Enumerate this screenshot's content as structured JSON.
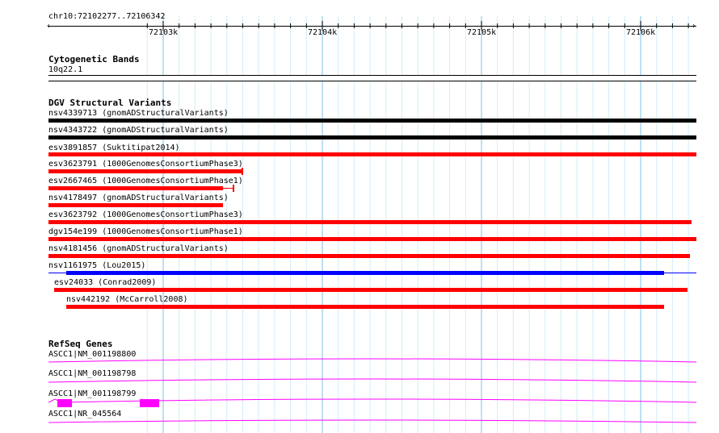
{
  "coords": "chr10:72102277..72106342",
  "ruler": {
    "ticks": [
      "72103k",
      "72104k",
      "72105k",
      "72106k"
    ]
  },
  "tracks": {
    "cytoband": {
      "title": "Cytogenetic Bands",
      "band": "10q22.1"
    },
    "dgv": {
      "title": "DGV Structural Variants",
      "items": [
        {
          "label": "nsv4339713 (gnomADStructuralVariants)",
          "color": "#000000"
        },
        {
          "label": "nsv4343722 (gnomADStructuralVariants)",
          "color": "#000000"
        },
        {
          "label": "esv3891857 (Suktitipat2014)",
          "color": "#ff0000"
        },
        {
          "label": "esv3623791 (1000GenomesConsortiumPhase3)",
          "color": "#ff0000"
        },
        {
          "label": "esv2667465 (1000GenomesConsortiumPhase1)",
          "color": "#ff0000"
        },
        {
          "label": "nsv4178497 (gnomADStructuralVariants)",
          "color": "#ff0000"
        },
        {
          "label": "esv3623792 (1000GenomesConsortiumPhase3)",
          "color": "#ff0000"
        },
        {
          "label": "dgv154e199 (1000GenomesConsortiumPhase1)",
          "color": "#ff0000"
        },
        {
          "label": "nsv4181456 (gnomADStructuralVariants)",
          "color": "#ff0000"
        },
        {
          "label": "nsv1161975 (Lou2015)",
          "color": "#0000ff"
        },
        {
          "label": "esv24033 (Conrad2009)",
          "color": "#ff0000"
        },
        {
          "label": "nsv442192 (McCarroll2008)",
          "color": "#ff0000"
        }
      ]
    },
    "refseq": {
      "title": "RefSeq Genes",
      "color": "#ff00ff",
      "items": [
        {
          "label": "ASCC1|NM_001198800"
        },
        {
          "label": "ASCC1|NM_001198798"
        },
        {
          "label": "ASCC1|NM_001198799"
        },
        {
          "label": "ASCC1|NR_045564"
        }
      ]
    }
  }
}
